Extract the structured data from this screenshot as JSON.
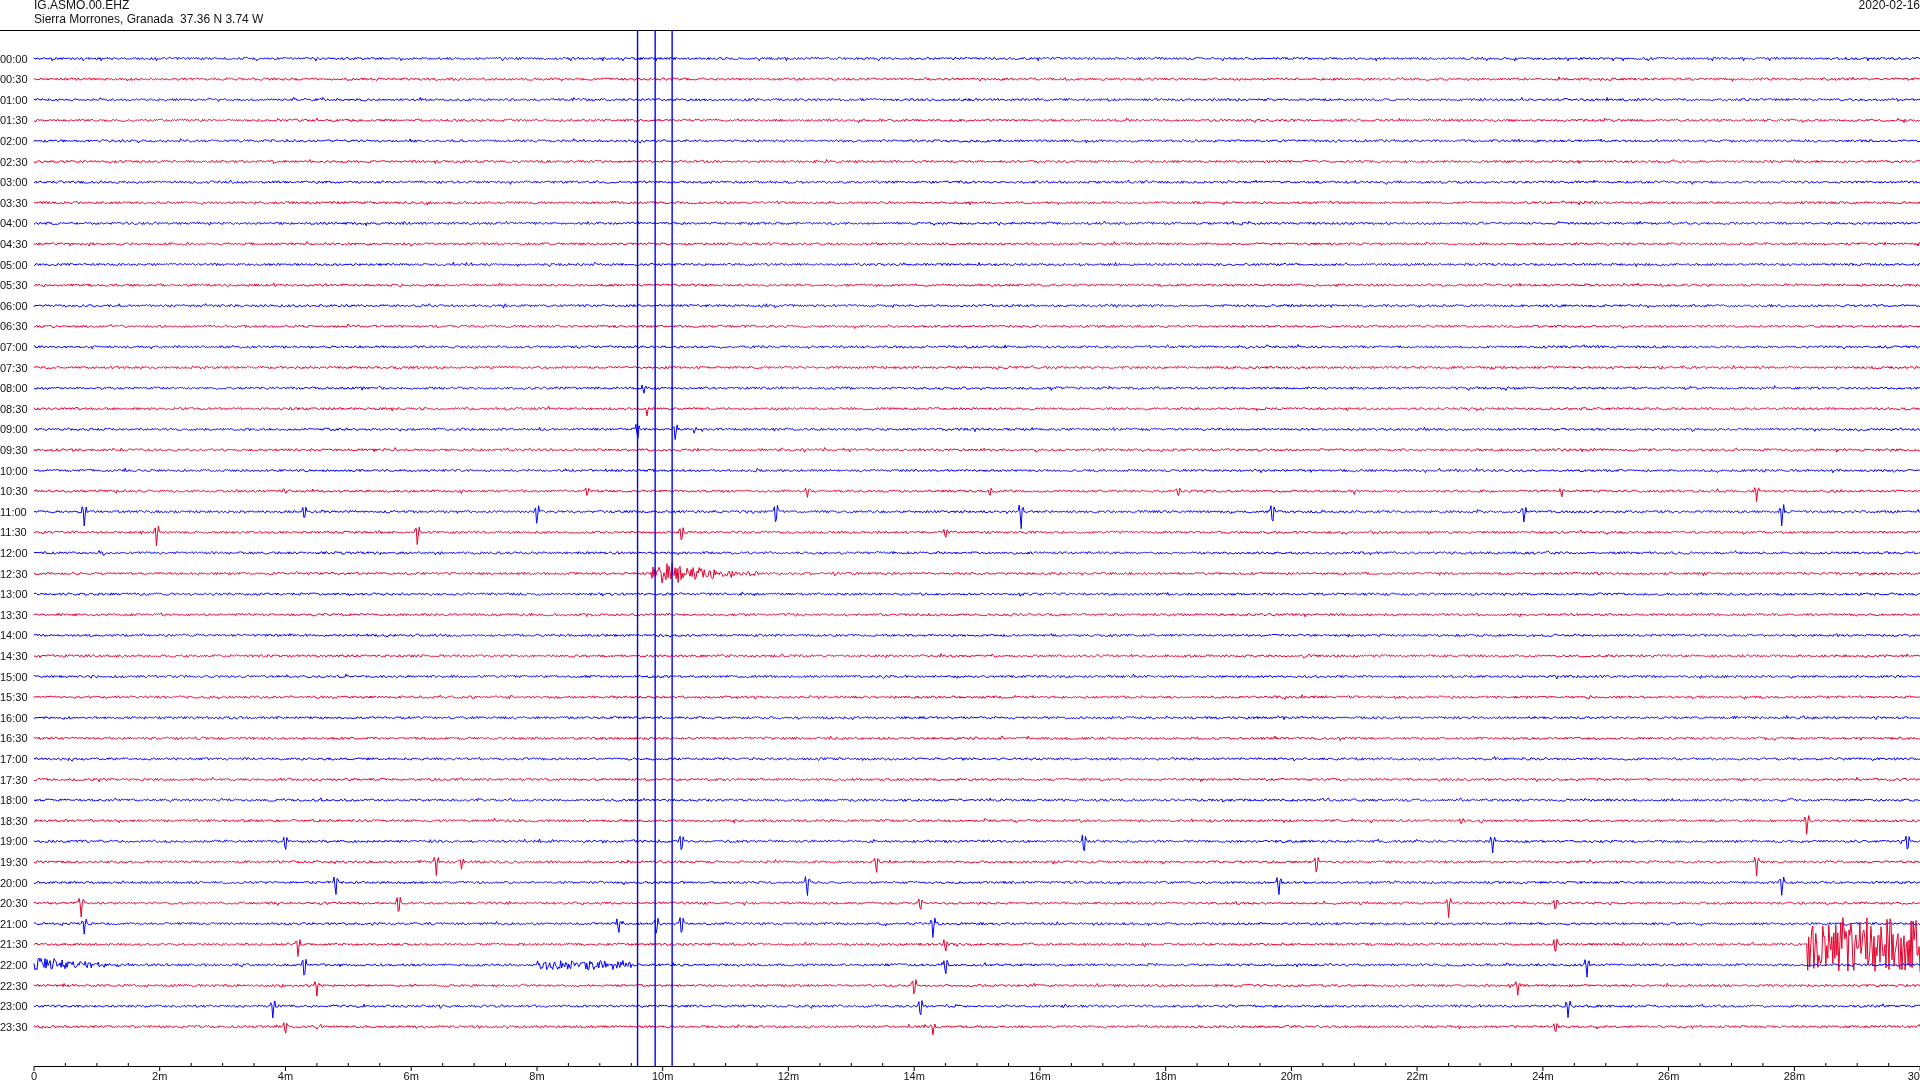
{
  "header": {
    "station": "IG.ASMO.00.EHZ",
    "location": "Sierra Morrones, Granada  37.36 N 3.74 W",
    "date": "2020-02-16"
  },
  "rows": [
    {
      "time": "00:00",
      "color": "#0000ff"
    },
    {
      "time": "00:30",
      "color": "#e8002a"
    },
    {
      "time": "01:00",
      "color": "#0000ff"
    },
    {
      "time": "01:30",
      "color": "#e8002a"
    },
    {
      "time": "02:00",
      "color": "#0000ff"
    },
    {
      "time": "02:30",
      "color": "#e8002a"
    },
    {
      "time": "03:00",
      "color": "#0000ff"
    },
    {
      "time": "03:30",
      "color": "#e8002a"
    },
    {
      "time": "04:00",
      "color": "#0000ff"
    },
    {
      "time": "04:30",
      "color": "#e8002a"
    },
    {
      "time": "05:00",
      "color": "#0000ff"
    },
    {
      "time": "05:30",
      "color": "#e8002a"
    },
    {
      "time": "06:00",
      "color": "#0000ff"
    },
    {
      "time": "06:30",
      "color": "#e8002a"
    },
    {
      "time": "07:00",
      "color": "#0000ff"
    },
    {
      "time": "07:30",
      "color": "#e8002a"
    },
    {
      "time": "08:00",
      "color": "#0000ff"
    },
    {
      "time": "08:30",
      "color": "#e8002a"
    },
    {
      "time": "09:00",
      "color": "#0000ff"
    },
    {
      "time": "09:30",
      "color": "#e8002a"
    },
    {
      "time": "10:00",
      "color": "#0000ff"
    },
    {
      "time": "10:30",
      "color": "#e8002a"
    },
    {
      "time": "11:00",
      "color": "#0000ff"
    },
    {
      "time": "11:30",
      "color": "#e8002a"
    },
    {
      "time": "12:00",
      "color": "#0000ff"
    },
    {
      "time": "12:30",
      "color": "#e8002a"
    },
    {
      "time": "13:00",
      "color": "#0000ff"
    },
    {
      "time": "13:30",
      "color": "#e8002a"
    },
    {
      "time": "14:00",
      "color": "#0000ff"
    },
    {
      "time": "14:30",
      "color": "#e8002a"
    },
    {
      "time": "15:00",
      "color": "#0000ff"
    },
    {
      "time": "15:30",
      "color": "#e8002a"
    },
    {
      "time": "16:00",
      "color": "#0000ff"
    },
    {
      "time": "16:30",
      "color": "#e8002a"
    },
    {
      "time": "17:00",
      "color": "#0000ff"
    },
    {
      "time": "17:30",
      "color": "#e8002a"
    },
    {
      "time": "18:00",
      "color": "#0000ff"
    },
    {
      "time": "18:30",
      "color": "#e8002a"
    },
    {
      "time": "19:00",
      "color": "#0000ff"
    },
    {
      "time": "19:30",
      "color": "#e8002a"
    },
    {
      "time": "20:00",
      "color": "#0000ff"
    },
    {
      "time": "20:30",
      "color": "#e8002a"
    },
    {
      "time": "21:00",
      "color": "#0000ff"
    },
    {
      "time": "21:30",
      "color": "#e8002a"
    },
    {
      "time": "22:00",
      "color": "#0000ff"
    },
    {
      "time": "22:30",
      "color": "#e8002a"
    },
    {
      "time": "23:00",
      "color": "#0000ff"
    },
    {
      "time": "23:30",
      "color": "#e8002a"
    }
  ],
  "axis": {
    "ticks": [
      "0",
      "2m",
      "4m",
      "6m",
      "8m",
      "10m",
      "12m",
      "14m",
      "16m",
      "18m",
      "20m",
      "22m",
      "24m",
      "26m",
      "28m",
      "30"
    ]
  }
}
